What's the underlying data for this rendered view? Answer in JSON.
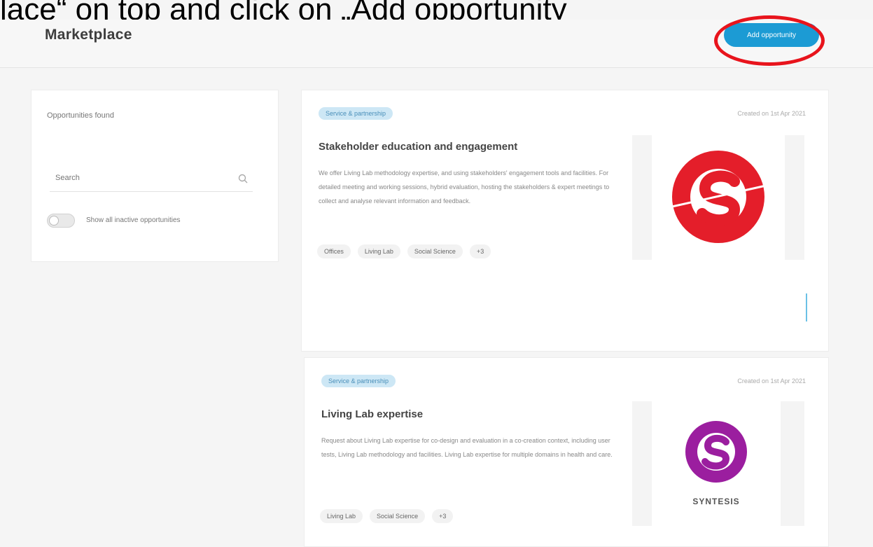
{
  "annotation": "lace“ on top and click on „Add opportunity",
  "header": {
    "title": "Marketplace",
    "add_button_label": "Add opportunity"
  },
  "filters": {
    "heading": "Opportunities found",
    "search_placeholder": "Search",
    "toggle_label": "Show all inactive opportunities"
  },
  "opportunities": [
    {
      "tag": "Service & partnership",
      "date": "Created on 1st Apr 2021",
      "title": "Stakeholder education and engagement",
      "description": "We offer Living Lab methodology expertise, and using stakeholders' engagement tools and facilities. For detailed meeting and working sessions, hybrid evaluation, hosting the stakeholders & expert meetings to collect and analyse relevant information and feedback.",
      "chips": [
        "Offices",
        "Living Lab",
        "Social Science",
        "+3"
      ],
      "logo_color": "#e41e2a"
    },
    {
      "tag": "Service & partnership",
      "date": "Created on 1st Apr 2021",
      "title": "Living Lab expertise",
      "description": "Request about Living Lab expertise for co-design and evaluation in a co-creation context, including user tests, Living Lab methodology and facilities. Living Lab expertise for multiple domains in health and care.",
      "chips": [
        "Living Lab",
        "Social Science",
        "+3"
      ],
      "logo_color": "#9b1e9f",
      "logo_caption": "SYNTESIS"
    }
  ],
  "colors": {
    "accent": "#1c9bd4",
    "highlight": "#e8141c",
    "tag_bg": "#cde7f5"
  }
}
